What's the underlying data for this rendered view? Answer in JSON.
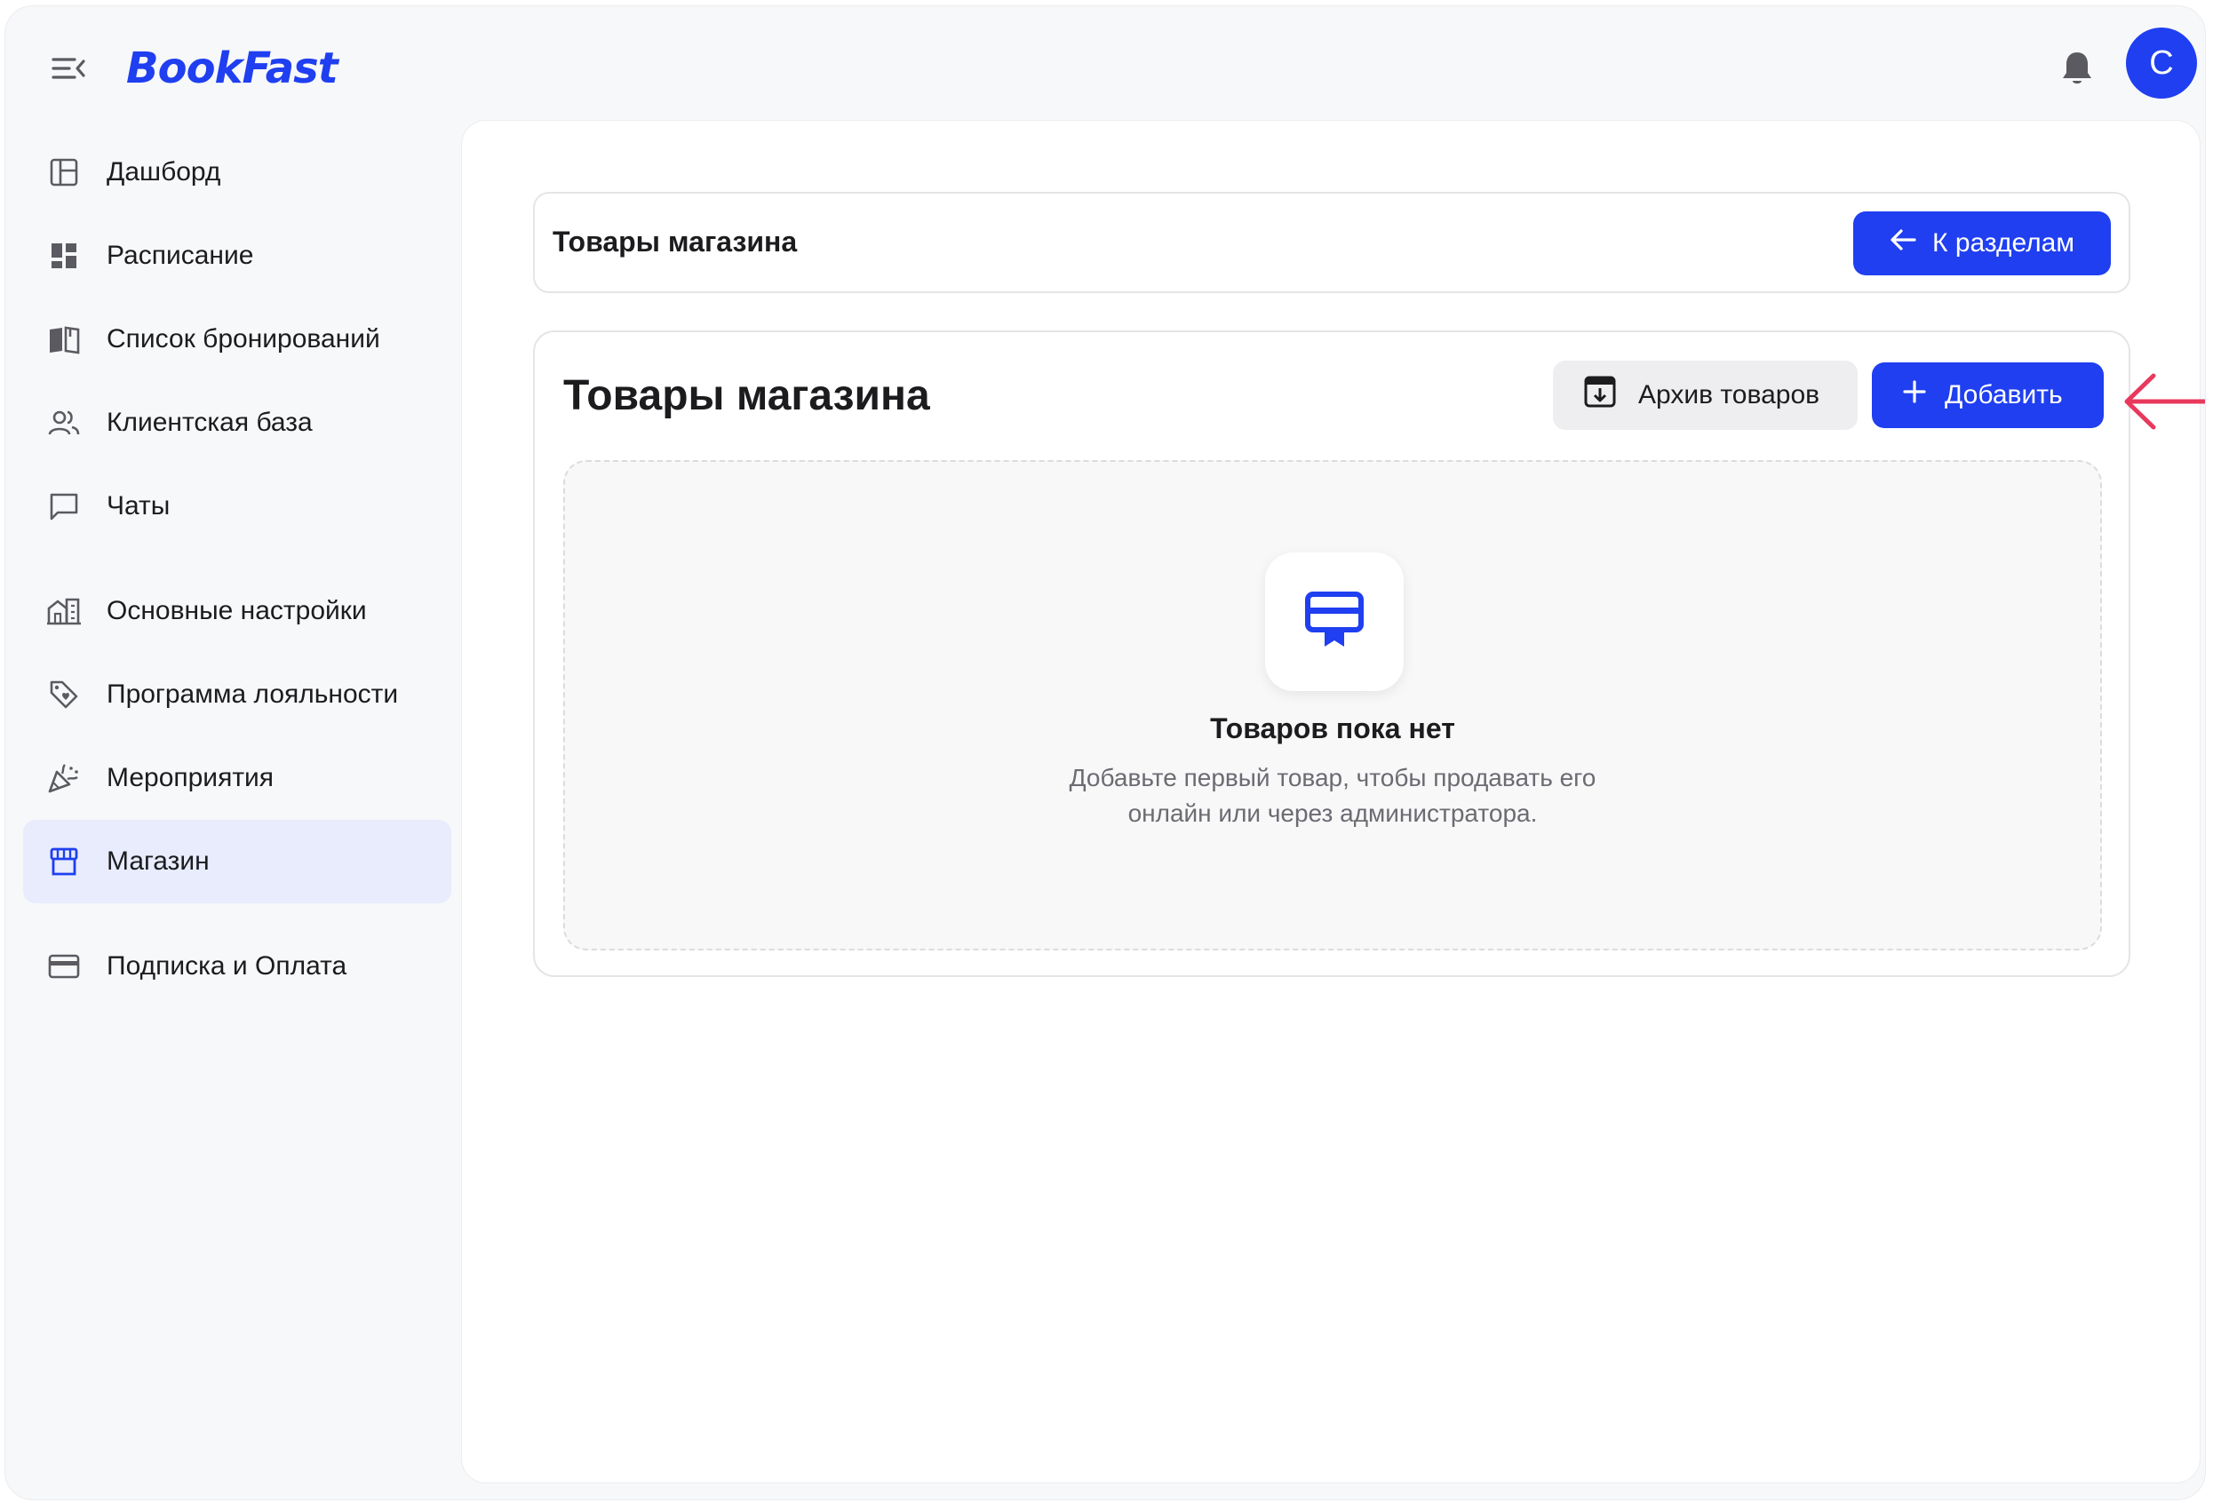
{
  "header": {
    "logo_text": "BookFast",
    "avatar_initial": "C",
    "icons": [
      "menu-collapse-icon",
      "bell-icon"
    ]
  },
  "sidebar": {
    "items": [
      {
        "label": "Дашборд",
        "icon": "dashboard-layout-icon",
        "active": false
      },
      {
        "label": "Расписание",
        "icon": "schedule-grid-icon",
        "active": false
      },
      {
        "label": "Список бронирований",
        "icon": "book-open-icon",
        "active": false
      },
      {
        "label": "Клиентская база",
        "icon": "users-icon",
        "active": false
      },
      {
        "label": "Чаты",
        "icon": "chat-icon",
        "active": false
      },
      {
        "label": "Основные настройки",
        "icon": "buildings-icon",
        "active": false
      },
      {
        "label": "Программа лояльности",
        "icon": "tag-heart-icon",
        "active": false
      },
      {
        "label": "Мероприятия",
        "icon": "party-popper-icon",
        "active": false
      },
      {
        "label": "Магазин",
        "icon": "store-icon",
        "active": true
      },
      {
        "label": "Подписка и Оплата",
        "icon": "credit-card-icon",
        "active": false
      }
    ]
  },
  "topbar": {
    "title": "Товары магазина",
    "back_label": "К разделам"
  },
  "panel": {
    "title": "Товары магазина",
    "archive_label": "Архив товаров",
    "add_label": "Добавить"
  },
  "empty_state": {
    "title": "Товаров пока нет",
    "line1": "Добавьте первый товар, чтобы продавать его",
    "line2": "онлайн или через администратора."
  },
  "colors": {
    "accent": "#1f3ff0",
    "active_bg": "#e8ecfd",
    "annotation_arrow": "#e8395c"
  }
}
